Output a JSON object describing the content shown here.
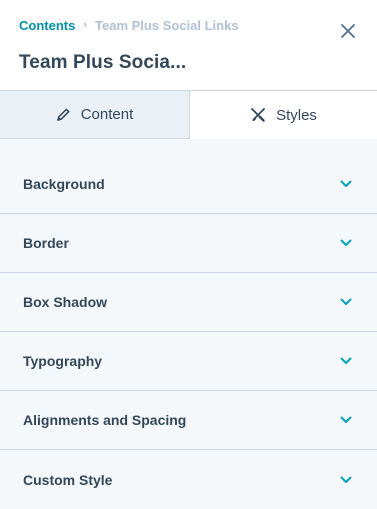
{
  "breadcrumb": {
    "link": "Contents",
    "separator": "›",
    "current": "Team Plus Social Links"
  },
  "title": "Team Plus Socia...",
  "tabs": [
    {
      "label": "Content",
      "icon": "pencil-icon",
      "active": false
    },
    {
      "label": "Styles",
      "icon": "brush-icon",
      "active": true
    }
  ],
  "sections": [
    {
      "label": "Background"
    },
    {
      "label": "Border"
    },
    {
      "label": "Box Shadow"
    },
    {
      "label": "Typography"
    },
    {
      "label": "Alignments and Spacing"
    },
    {
      "label": "Custom Style"
    }
  ],
  "colors": {
    "accent": "#00a4bd",
    "link": "#0091ae",
    "text": "#33475b",
    "muted": "#b0c1d4"
  }
}
